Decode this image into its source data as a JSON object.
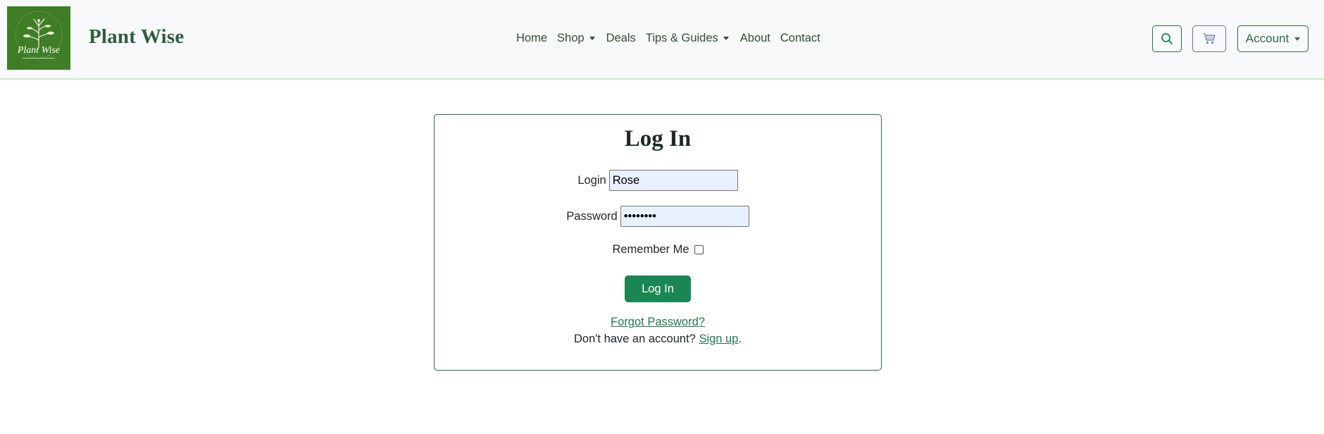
{
  "brand": {
    "logo_text": "Plant Wise",
    "name": "Plant Wise",
    "logo_color": "#3f7d26"
  },
  "nav": {
    "items": [
      {
        "label": "Home",
        "has_dropdown": false
      },
      {
        "label": "Shop",
        "has_dropdown": true
      },
      {
        "label": "Deals",
        "has_dropdown": false
      },
      {
        "label": "Tips & Guides",
        "has_dropdown": true
      },
      {
        "label": "About",
        "has_dropdown": false
      },
      {
        "label": "Contact",
        "has_dropdown": false
      }
    ],
    "search_icon": "search-icon",
    "cart_icon": "cart-icon",
    "account_label": "Account"
  },
  "login": {
    "title": "Log In",
    "login_label": "Login",
    "login_value": "Rose",
    "password_label": "Password",
    "password_value": "••••••••",
    "remember_label": "Remember Me",
    "remember_checked": false,
    "submit_label": "Log In",
    "forgot_label": "Forgot Password?",
    "signup_prefix": "Don't have an account? ",
    "signup_link": "Sign up",
    "signup_suffix": "."
  },
  "colors": {
    "accent": "#198754",
    "brand_text": "#2f5e3e",
    "navbar_bg": "#f8f9fa"
  }
}
